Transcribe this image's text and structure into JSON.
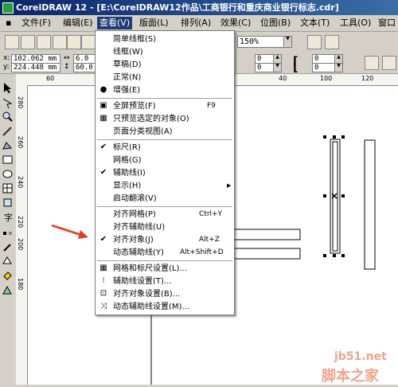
{
  "window": {
    "title": "CorelDRAW 12 - [E:\\CorelDRAW12作品\\工商银行和重庆商业银行标志.cdr]"
  },
  "menubar": [
    {
      "label": "文件(F)"
    },
    {
      "label": "编辑(E)"
    },
    {
      "label": "查看(V)"
    },
    {
      "label": "版面(L)"
    },
    {
      "label": "排列(A)"
    },
    {
      "label": "效果(C)"
    },
    {
      "label": "位图(B)"
    },
    {
      "label": "文本(T)"
    },
    {
      "label": "工具(O)"
    },
    {
      "label": "窗口"
    }
  ],
  "toolbar": {
    "zoom": "150%"
  },
  "property_bar": {
    "x_label": "x:",
    "x_value": "102.062 mm",
    "y_label": "y:",
    "y_value": "224.448 mm",
    "w_value": "6.0 m",
    "h_value": "60.0",
    "field_a": "0",
    "field_b": "0",
    "field_c": "0",
    "field_d": "0"
  },
  "ruler": {
    "h_ticks": [
      "60",
      "40",
      "100",
      "120"
    ],
    "v_ticks": [
      "280",
      "260",
      "240",
      "220",
      "200",
      "180"
    ]
  },
  "view_menu": {
    "items": [
      {
        "label": "简单线框(S)",
        "shortcut": "",
        "check": ""
      },
      {
        "label": "线框(W)",
        "shortcut": "",
        "check": ""
      },
      {
        "label": "草稿(D)",
        "shortcut": "",
        "check": ""
      },
      {
        "label": "正常(N)",
        "shortcut": "",
        "check": ""
      },
      {
        "label": "增强(E)",
        "shortcut": "",
        "check": "radio"
      },
      {
        "label": "全屏预览(F)",
        "shortcut": "F9",
        "check": ""
      },
      {
        "label": "只预览选定的对象(O)",
        "shortcut": "",
        "check": ""
      },
      {
        "label": "页面分类视图(A)",
        "shortcut": "",
        "check": ""
      },
      {
        "label": "标尺(R)",
        "shortcut": "",
        "check": "check"
      },
      {
        "label": "网格(G)",
        "shortcut": "",
        "check": ""
      },
      {
        "label": "辅助线(I)",
        "shortcut": "",
        "check": "check"
      },
      {
        "label": "显示(H)",
        "shortcut": "",
        "check": ""
      },
      {
        "label": "启动翻滚(V)",
        "shortcut": "",
        "check": ""
      },
      {
        "label": "对齐网格(P)",
        "shortcut": "Ctrl+Y",
        "check": ""
      },
      {
        "label": "对齐辅助线(U)",
        "shortcut": "",
        "check": ""
      },
      {
        "label": "对齐对象(J)",
        "shortcut": "Alt+Z",
        "check": "check"
      },
      {
        "label": "动态辅助线(Y)",
        "shortcut": "Alt+Shift+D",
        "check": ""
      },
      {
        "label": "网格和标尺设置(L)...",
        "shortcut": "",
        "check": ""
      },
      {
        "label": "辅助线设置(T)...",
        "shortcut": "",
        "check": ""
      },
      {
        "label": "对齐对象设置(B)...",
        "shortcut": "",
        "check": ""
      },
      {
        "label": "动态辅助线设置(M)...",
        "shortcut": "",
        "check": ""
      }
    ],
    "submenu_arrow": "▶"
  },
  "watermark": {
    "site": "jb51.net",
    "brand": "脚本之家"
  },
  "colors": {
    "menu_highlight": "#1e3c78",
    "arrow": "#e23b2a",
    "watermark": "#f2a38c"
  }
}
